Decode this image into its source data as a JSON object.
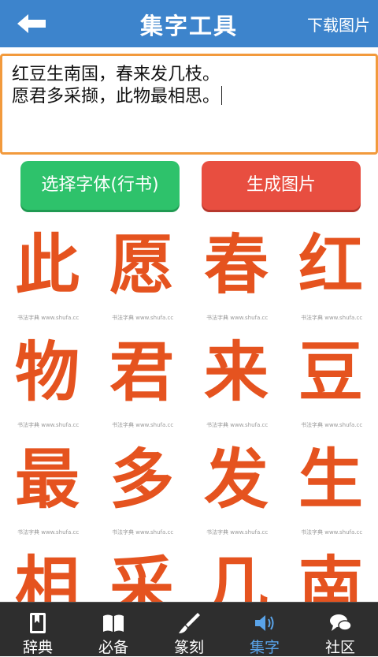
{
  "header": {
    "title": "集字工具",
    "download_label": "下载图片"
  },
  "editor": {
    "line1": "红豆生南国，春来发几枝。",
    "line2": "愿君多采撷，此物最相思。"
  },
  "buttons": {
    "choose_font": "选择字体(行书)",
    "generate": "生成图片"
  },
  "grid": {
    "watermark": "书法字典 www.shufa.cc",
    "chars": [
      "此",
      "愿",
      "春",
      "红",
      "物",
      "君",
      "来",
      "豆",
      "最",
      "多",
      "发",
      "生",
      "相",
      "采",
      "几",
      "南"
    ]
  },
  "tabs": [
    {
      "label": "辞典",
      "icon": "bookmark-book-icon"
    },
    {
      "label": "必备",
      "icon": "open-book-icon"
    },
    {
      "label": "篆刻",
      "icon": "brush-icon"
    },
    {
      "label": "集字",
      "icon": "speaker-icon"
    },
    {
      "label": "社区",
      "icon": "chat-bubbles-icon"
    }
  ],
  "colors": {
    "header_bg": "#3d84cc",
    "accent_orange": "#f29a3c",
    "green_button": "#2ec26b",
    "red_button": "#e84e40",
    "calligraphy": "#e5531f",
    "tab_active": "#5aa4ea"
  }
}
